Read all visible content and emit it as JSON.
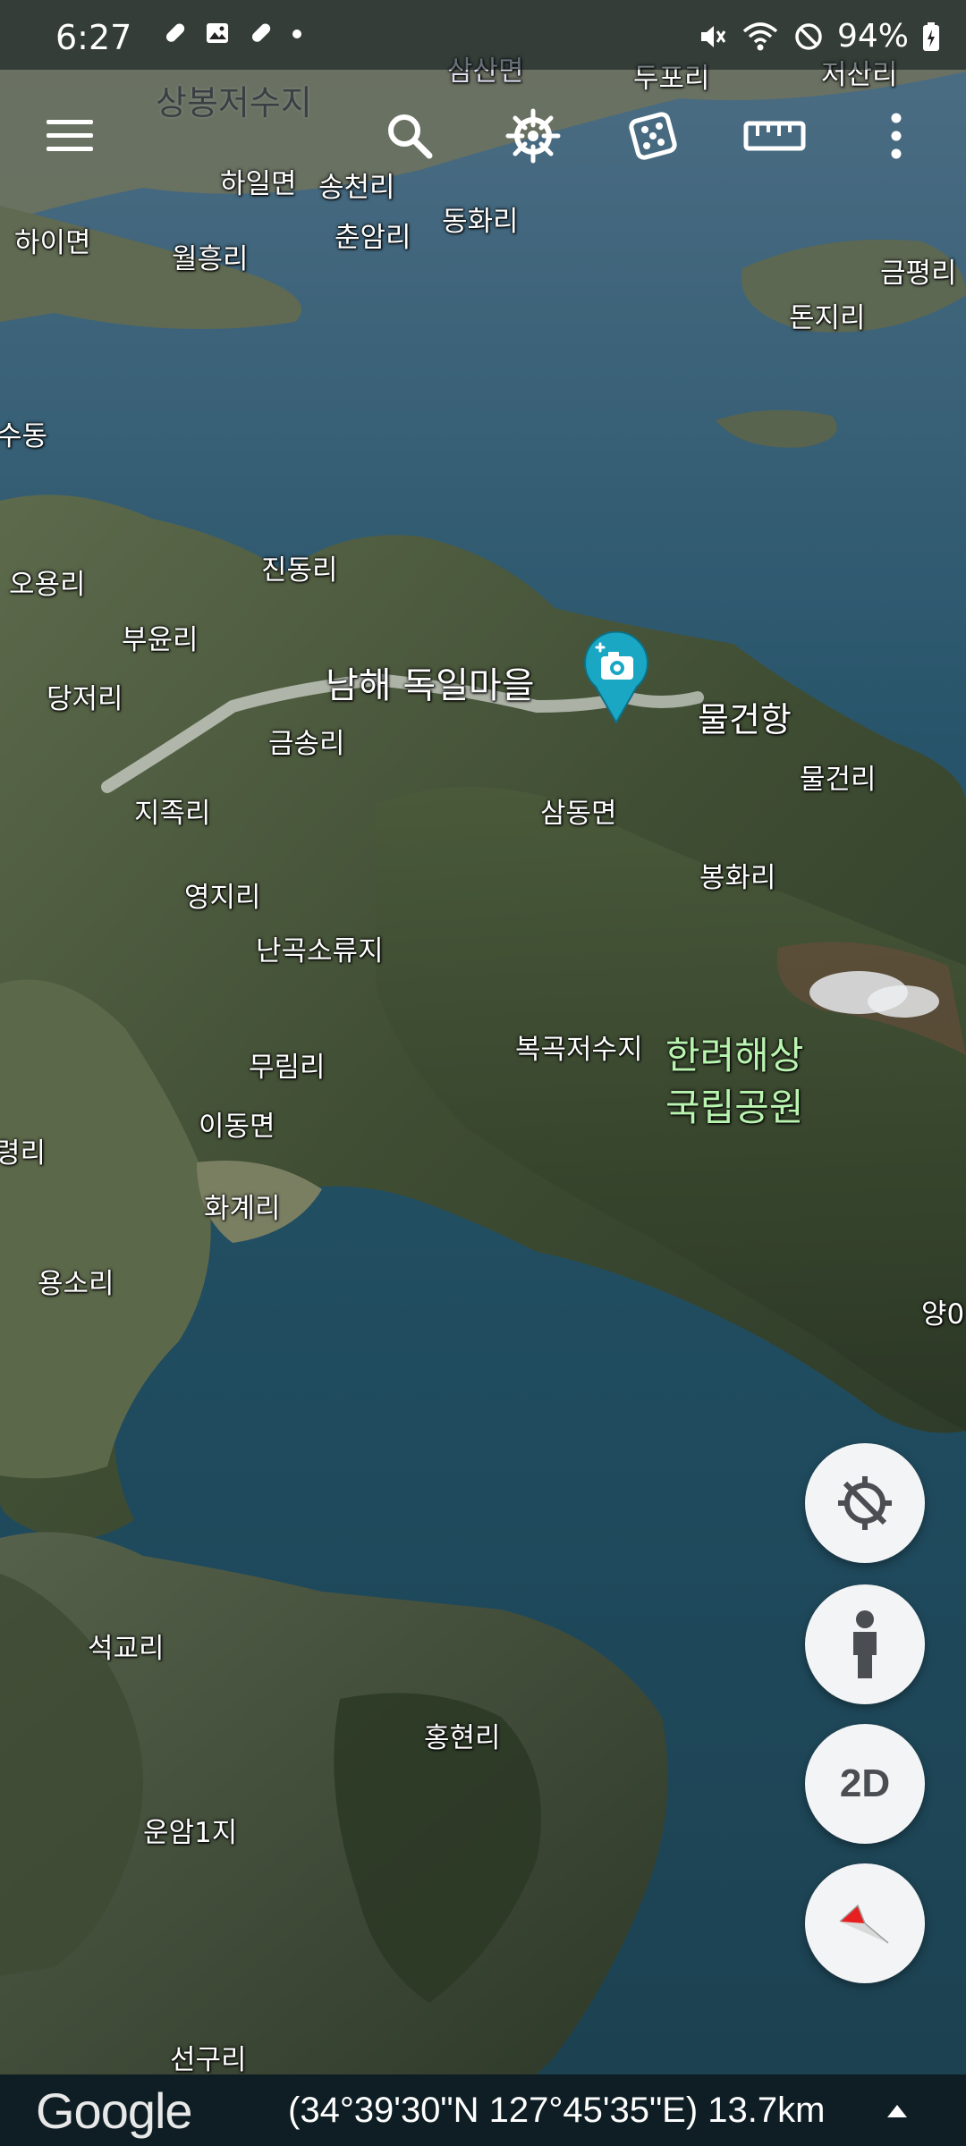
{
  "status_bar": {
    "time": "6:27",
    "battery": "94%"
  },
  "toolbar": {
    "menu_icon": "menu-icon",
    "search_icon": "search-icon",
    "voyager_icon": "ship-wheel-icon",
    "random_icon": "dice-icon",
    "measure_icon": "ruler-icon",
    "more_icon": "more-vert-icon"
  },
  "map": {
    "labels": {
      "sangbong": "상봉저수지",
      "samsan": "삼산면",
      "dupo": "두포리",
      "jisan": "저산리",
      "hail": "하일면",
      "songcheon": "송천리",
      "dongwha": "동화리",
      "haimyeon": "하이면",
      "wolheung": "월흥리",
      "chunam": "춘암리",
      "geumpyeong": "금평리",
      "donji": "돈지리",
      "sudong": "수동",
      "ogri": "오용리",
      "jindong": "진동리",
      "buyun": "부윤리",
      "dangjeo": "당저리",
      "village": "남해 독일마을",
      "mulgeon_port": "물건항",
      "geumsong": "금송리",
      "mulgeon_ri": "물건리",
      "jijok": "지족리",
      "samdong": "삼동면",
      "bonghwa": "봉화리",
      "yeongji": "영지리",
      "nangok": "난곡소류지",
      "bokgok": "복곡저수지",
      "park_line1": "한려해상",
      "park_line2": "국립공원",
      "murim": "무림리",
      "idong": "이동면",
      "ryeong": "령리",
      "hwagye": "화계리",
      "yongso": "용소리",
      "yang": "양0",
      "seokgyo": "석교리",
      "hongheon": "홍현리",
      "unam": "운암1지",
      "seongu": "선구리"
    }
  },
  "controls": {
    "my_location_icon": "location-disabled-icon",
    "street_view_icon": "pegman-icon",
    "view_toggle": "2D",
    "compass_icon": "compass-icon"
  },
  "bottom_bar": {
    "logo": "Google",
    "coordinates": "(34°39'30\"N 127°45'35\"E) 13.7km",
    "expand_icon": "chevron-up-icon"
  },
  "colors": {
    "sea": "#2b5466",
    "land": "#4c5a3c",
    "park_label": "#b9f5b0",
    "pin": "#1aa7c4"
  }
}
